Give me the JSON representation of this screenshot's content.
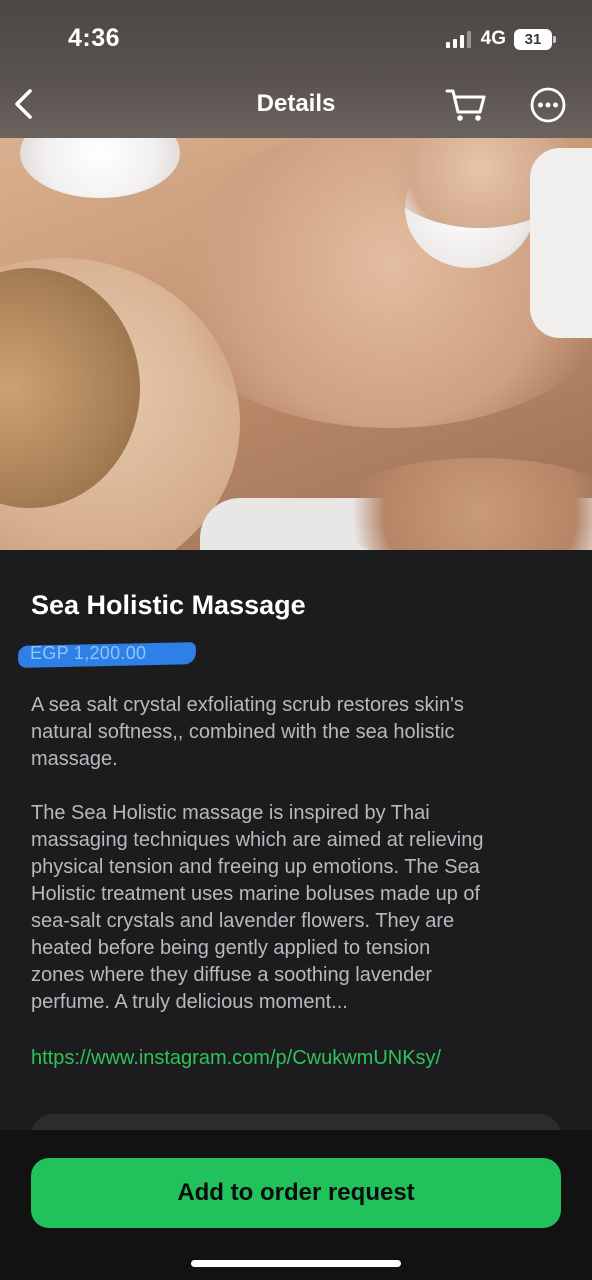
{
  "status_bar": {
    "time": "4:36",
    "network": "4G",
    "battery": "31"
  },
  "nav": {
    "title": "Details",
    "back_icon": "chevron-left-icon",
    "cart_icon": "cart-icon",
    "more_icon": "more-circle-icon"
  },
  "product": {
    "name": "Sea Holistic Massage",
    "price": "EGP 1,200.00",
    "description_1": "A sea salt crystal exfoliating scrub restores skin's\nnatural softness,, combined with the sea holistic\nmassage.",
    "description_2": "The Sea Holistic massage is inspired by Thai\nmassaging techniques which are aimed at relieving\nphysical tension and freeing up emotions. The Sea\nHolistic treatment uses marine boluses made up of\nsea-salt crystals and lavender flowers. They are\nheated before being gently applied to tension\nzones where they diffuse a soothing lavender\nperfume. A truly delicious moment...",
    "link": "https://www.instagram.com/p/CwukwmUNKsy/"
  },
  "actions": {
    "add_to_order": "Add to order request"
  },
  "colors": {
    "background": "#1c1c1e",
    "accent_green": "#21c15c",
    "link_green": "#30c15b",
    "price_highlight": "#2e7fe6"
  }
}
